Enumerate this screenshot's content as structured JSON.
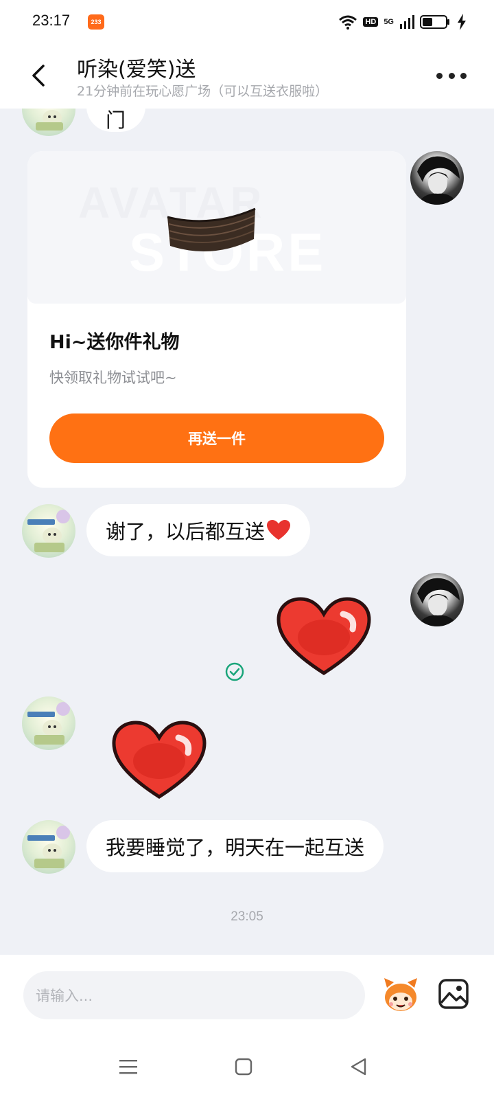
{
  "status_bar": {
    "time": "23:17",
    "app_badge": "233",
    "network_hd": "HD",
    "network_5g": "5G"
  },
  "header": {
    "contact_name": "听染(爱笑)送",
    "contact_status": "21分钟前在玩心愿广场（可以互送衣服啦）"
  },
  "messages": {
    "partial_text": "门",
    "gift_card": {
      "watermark_line1": "AVATAR",
      "watermark_line2": "STORE",
      "title": "Hi~送你件礼物",
      "subtitle": "快领取礼物试试吧~",
      "button_label": "再送一件"
    },
    "reply_1": "谢了，以后都互送",
    "reply_2": "我要睡觉了，明天在一起互送",
    "timestamp": "23:05"
  },
  "input": {
    "placeholder": "请输入..."
  },
  "colors": {
    "accent": "#ff7113",
    "read_check": "#1aa57a",
    "heart": "#e8332e"
  },
  "icons": [
    "back-icon",
    "more-icon",
    "heart-emoji",
    "check-circle-icon",
    "mascot-emoji-icon",
    "image-icon",
    "menu-icon",
    "home-icon",
    "back-triangle-icon"
  ]
}
